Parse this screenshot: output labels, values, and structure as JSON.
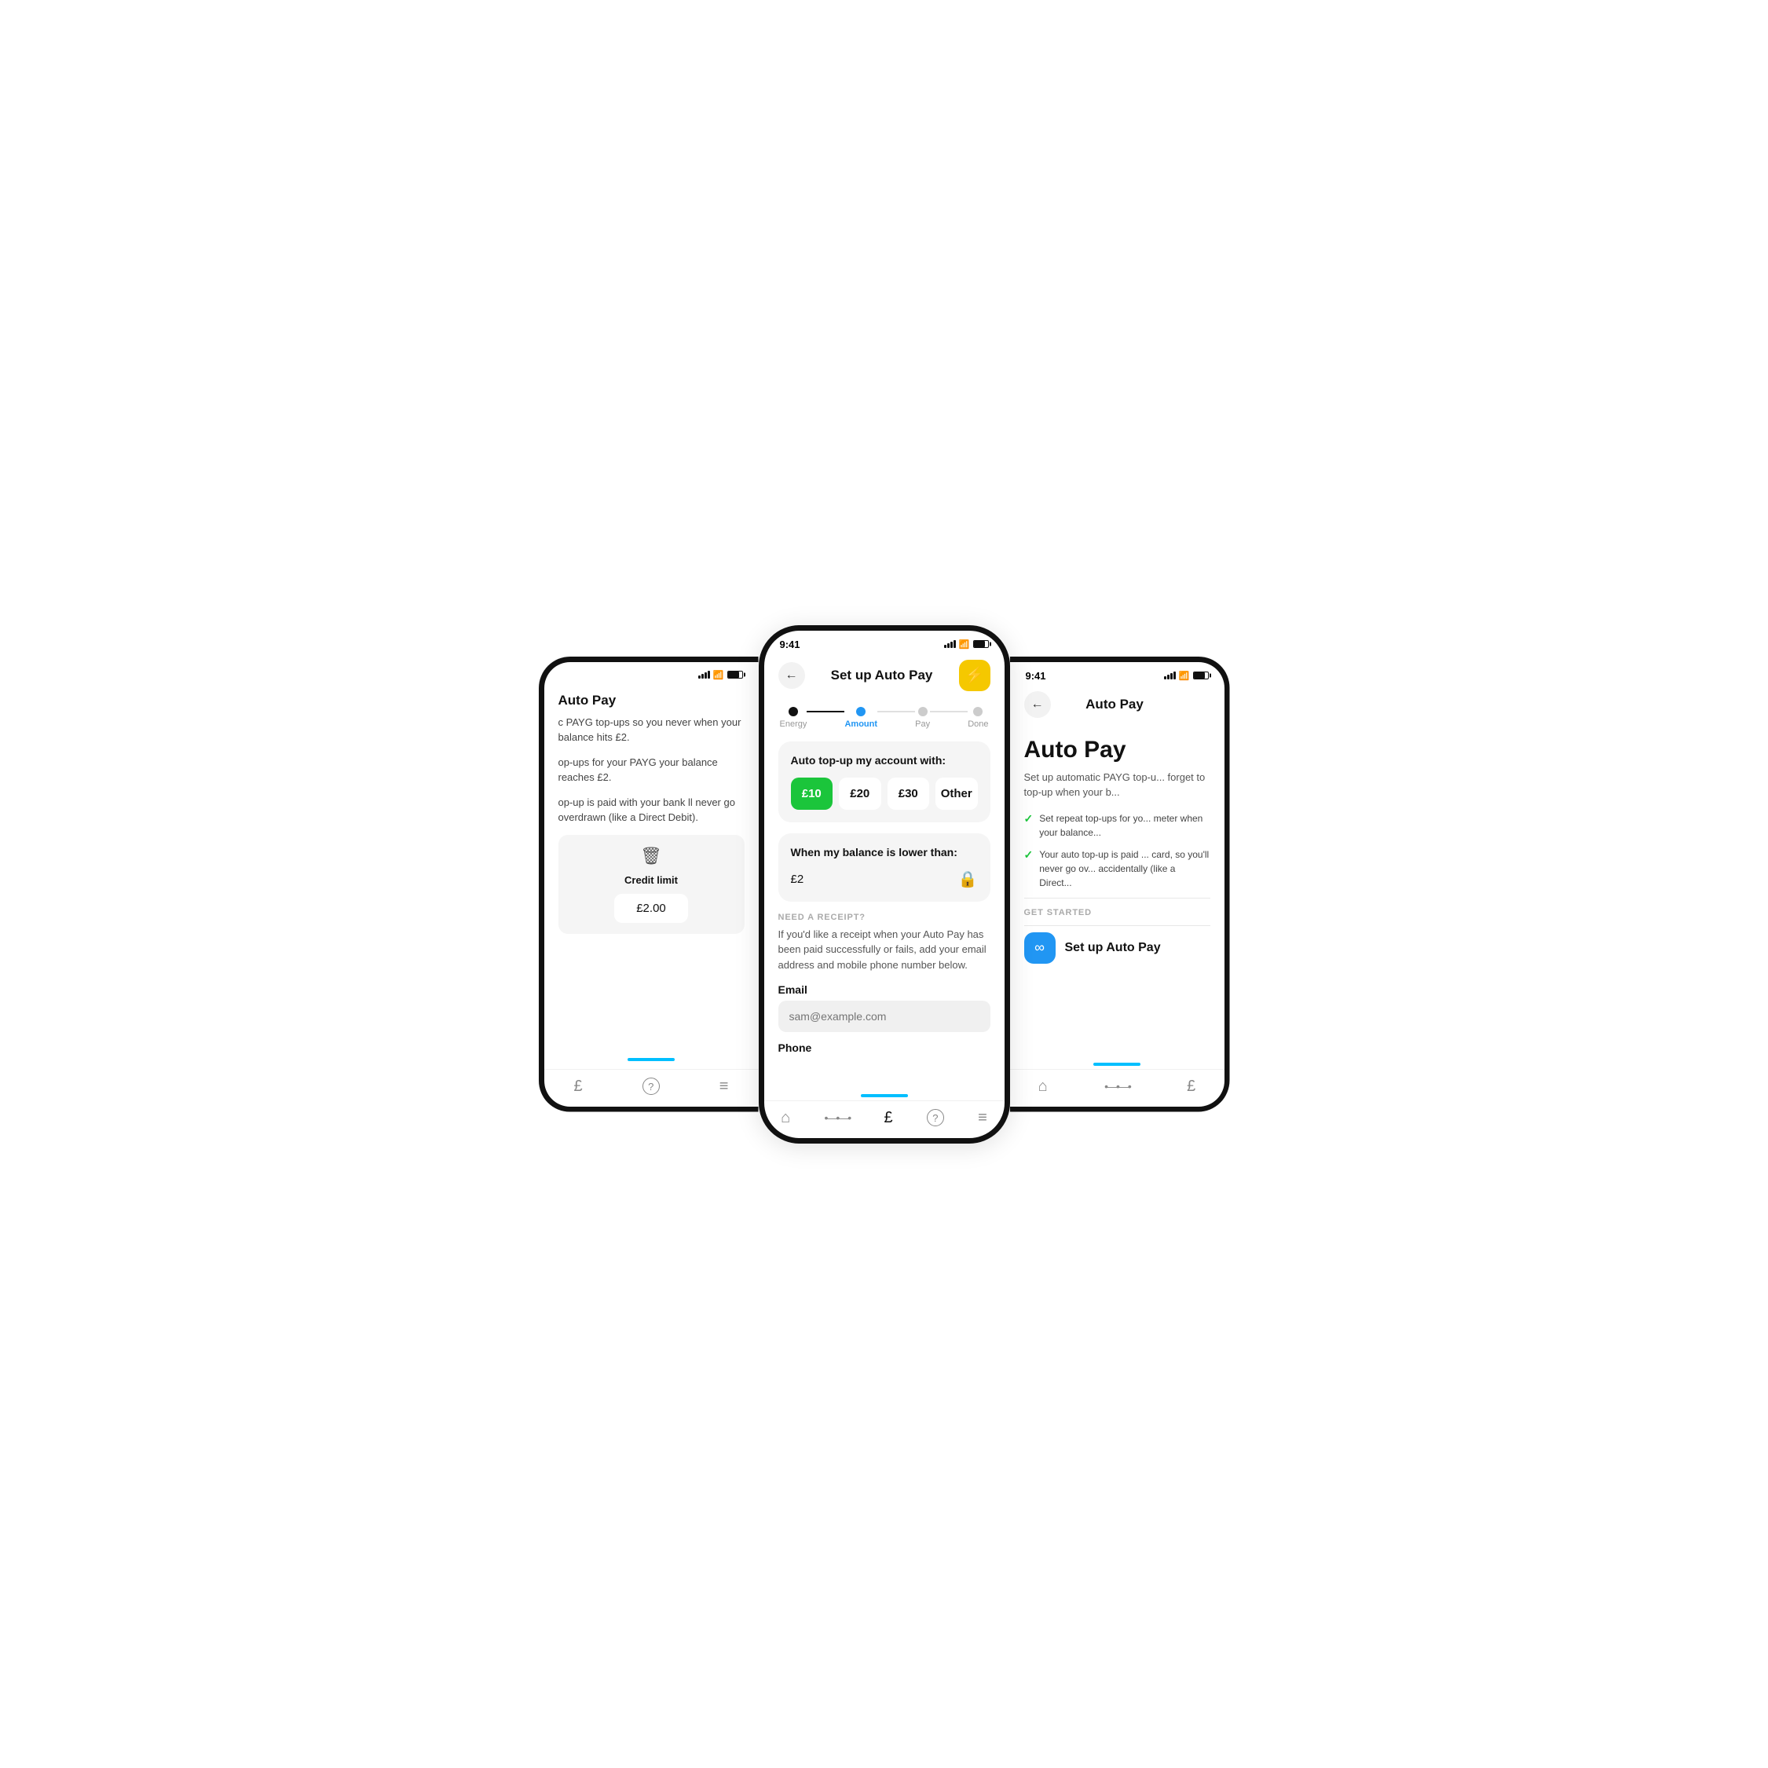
{
  "left_phone": {
    "title": "Auto Pay",
    "description_1": "c PAYG top-ups so you never when your balance hits £2.",
    "description_2": "op-ups for your PAYG your balance reaches £2.",
    "description_3": "op-up is paid with your bank ll never go overdrawn (like a Direct Debit).",
    "credit_limit_label": "Credit limit",
    "credit_limit_value": "£2.00",
    "nav_icons": [
      "home",
      "nodes",
      "money",
      "help",
      "menu"
    ]
  },
  "center_phone": {
    "status_time": "9:41",
    "back_label": "←",
    "title": "Set up Auto Pay",
    "lightning_icon": "⚡",
    "steps": [
      {
        "label": "Energy",
        "state": "filled"
      },
      {
        "label": "Amount",
        "state": "active"
      },
      {
        "label": "Pay",
        "state": "empty"
      },
      {
        "label": "Done",
        "state": "empty"
      }
    ],
    "card_topup_title": "Auto top-up my account with:",
    "amount_options": [
      {
        "value": "£10",
        "selected": true
      },
      {
        "value": "£20",
        "selected": false
      },
      {
        "value": "£30",
        "selected": false
      },
      {
        "value": "Other",
        "selected": false
      }
    ],
    "card_balance_title": "When my balance is lower than:",
    "balance_value": "£2",
    "receipt_section_label": "NEED A RECEIPT?",
    "receipt_text": "If you'd like a receipt when your Auto Pay has been paid successfully or fails, add your email address and mobile phone number below.",
    "email_label": "Email",
    "email_placeholder": "sam@example.com",
    "phone_label": "Phone",
    "nav_icons": [
      "home",
      "nodes",
      "money",
      "help",
      "menu"
    ]
  },
  "right_phone": {
    "status_time": "9:41",
    "back_label": "←",
    "title": "Auto Pay",
    "big_title": "Auto Pay",
    "description": "Set up automatic PAYG top-u... forget to top-up when your b...",
    "check_items": [
      "Set repeat top-ups for yo... meter when your balance...",
      "Your auto top-up is paid ... card, so you'll never go ov... accidentally (like a Direct..."
    ],
    "get_started_label": "GET STARTED",
    "setup_btn_icon": "∞",
    "setup_btn_label": "Set up Auto Pay",
    "nav_icons": [
      "home",
      "nodes",
      "money"
    ]
  },
  "colors": {
    "accent_blue": "#2196f3",
    "accent_green": "#1bc53b",
    "accent_yellow": "#f5c800",
    "accent_cyan": "#00bfff",
    "text_primary": "#111111",
    "text_secondary": "#555555",
    "bg_card": "#f5f5f5"
  }
}
